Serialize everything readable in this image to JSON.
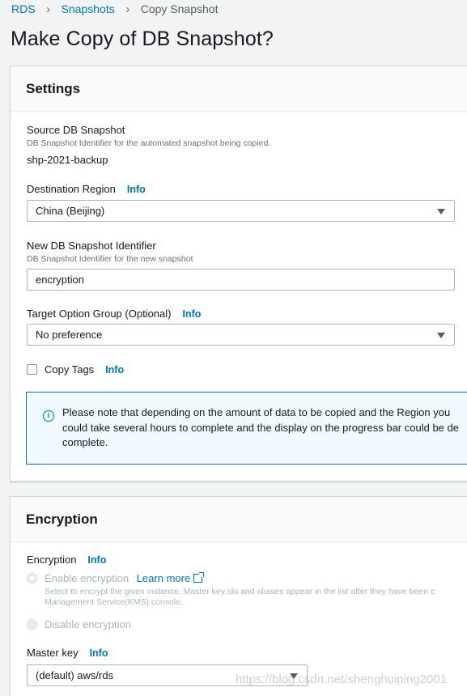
{
  "breadcrumb": {
    "items": [
      "RDS",
      "Snapshots"
    ],
    "current": "Copy Snapshot"
  },
  "page_title": "Make Copy of DB Snapshot?",
  "settings": {
    "title": "Settings",
    "source": {
      "label": "Source DB Snapshot",
      "desc": "DB Snapshot Identifier for the automated snapshot being copied.",
      "value": "shp-2021-backup"
    },
    "destination_region": {
      "label": "Destination Region",
      "info": "Info",
      "value": "China (Beijing)"
    },
    "new_identifier": {
      "label": "New DB Snapshot Identifier",
      "desc": "DB Snapshot Identifier for the new snapshot",
      "value": "encryption"
    },
    "option_group": {
      "label": "Target Option Group (Optional)",
      "info": "Info",
      "value": "No preference"
    },
    "copy_tags": {
      "label": "Copy Tags",
      "info": "Info",
      "checked": false
    },
    "notice": {
      "line1": "Please note that depending on the amount of data to be copied and the Region you",
      "line2": "could take several hours to complete and the display on the progress bar could be de",
      "line3": "complete."
    }
  },
  "encryption": {
    "title": "Encryption",
    "label": "Encryption",
    "info": "Info",
    "enable": {
      "label": "Enable encryption",
      "link": "Learn more",
      "desc_line1": "Select to encrypt the given instance. Master key ids and aliases appear in the list after they have been c",
      "desc_line2": "Management Service(KMS) console.",
      "selected": true
    },
    "disable": {
      "label": "Disable encryption",
      "selected": false
    },
    "master_key": {
      "label": "Master key",
      "info": "Info",
      "value": "(default) aws/rds"
    }
  },
  "watermark": "https://blog.csdn.net/shenghuiping2001",
  "colors": {
    "link": "#0073bb",
    "notice_bg": "#f1faff",
    "page_bg": "#f2f3f3"
  }
}
